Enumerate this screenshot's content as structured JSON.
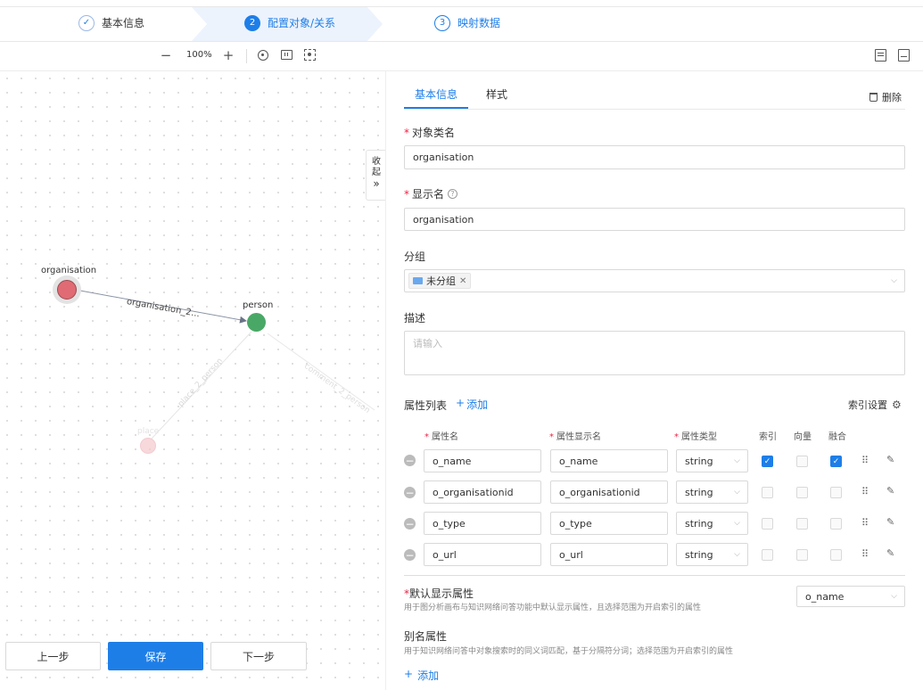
{
  "steps": [
    {
      "index": "✓",
      "label": "基本信息"
    },
    {
      "index": "2",
      "label": "配置对象/关系"
    },
    {
      "index": "3",
      "label": "映射数据"
    }
  ],
  "toolbar": {
    "zoom": "100%"
  },
  "canvas": {
    "collapse_label_1": "收",
    "collapse_label_2": "起",
    "collapse_arrow": "»",
    "nodes": [
      {
        "label": "organisation",
        "color": "#e06b74"
      },
      {
        "label": "person",
        "color": "#4aa867"
      },
      {
        "label": "place",
        "color": "#e06b74"
      }
    ],
    "edges": [
      {
        "label": "organisation_2..."
      },
      {
        "label": "place_2_person"
      },
      {
        "label": "comment_2_person"
      }
    ],
    "buttons": {
      "prev": "上一步",
      "save": "保存",
      "next": "下一步"
    }
  },
  "panel": {
    "tabs": [
      "基本信息",
      "样式"
    ],
    "delete_label": "删除",
    "object_name_label": "对象类名",
    "object_name_value": "organisation",
    "display_name_label": "显示名",
    "display_name_value": "organisation",
    "group_label": "分组",
    "group_tag": "未分组",
    "desc_label": "描述",
    "desc_placeholder": "请输入",
    "attr_list_label": "属性列表",
    "add_label": "添加",
    "index_settings_label": "索引设置",
    "columns": [
      "属性名",
      "属性显示名",
      "属性类型",
      "索引",
      "向量",
      "融合"
    ],
    "rows": [
      {
        "name": "o_name",
        "display": "o_name",
        "type": "string",
        "index": true,
        "vector": false,
        "fusion": true
      },
      {
        "name": "o_organisationid",
        "display": "o_organisationid",
        "type": "string",
        "index": false,
        "vector": false,
        "fusion": false
      },
      {
        "name": "o_type",
        "display": "o_type",
        "type": "string",
        "index": false,
        "vector": false,
        "fusion": false
      },
      {
        "name": "o_url",
        "display": "o_url",
        "type": "string",
        "index": false,
        "vector": false,
        "fusion": false
      }
    ],
    "default_display_label": "默认显示属性",
    "default_display_hint": "用于图分析画布与知识网络问答功能中默认显示属性，且选择范围为开启索引的属性",
    "default_display_value": "o_name",
    "alias_label": "别名属性",
    "alias_hint": "用于知识网络问答中对象搜索时的同义词匹配，基于分隔符分词；选择范围为开启索引的属性",
    "alias_add_label": "添加"
  },
  "colors": {
    "accent": "#1e7ee8",
    "step_active_bg": "#ecf3fd"
  }
}
